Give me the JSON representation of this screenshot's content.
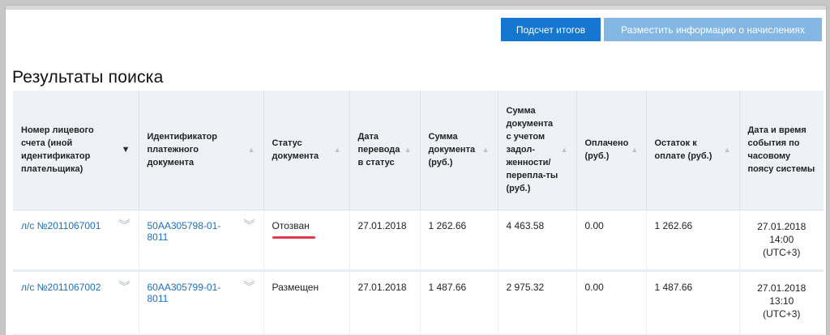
{
  "toolbar": {
    "totals_label": "Подсчет итогов",
    "publish_label": "Разместить информацию о начислениях"
  },
  "page": {
    "title": "Результаты поиска"
  },
  "table": {
    "columns": [
      {
        "label": "Номер лицевого счета (иной идентификатор плательщика)",
        "sort": "desc"
      },
      {
        "label": "Идентификатор платежного документа",
        "sort": "asc"
      },
      {
        "label": "Статус документа",
        "sort": "asc"
      },
      {
        "label": "Дата перевода в статус",
        "sort": "asc"
      },
      {
        "label": "Сумма документа (руб.)",
        "sort": "asc"
      },
      {
        "label": "Сумма документа с учетом задол-женности/ перепла-ты (руб.)",
        "sort": "asc"
      },
      {
        "label": "Оплачено (руб.)",
        "sort": "asc"
      },
      {
        "label": "Остаток к оплате (руб.)",
        "sort": "asc"
      },
      {
        "label": "Дата и время события по часовому поясу системы",
        "sort": "none"
      }
    ],
    "rows": [
      {
        "account": "л/с №2011067001",
        "doc_id": "50AA305798-01-8011",
        "status": "Отозван",
        "status_date": "27.01.2018",
        "amount": "1 262.66",
        "amount_with_debt": "4 463.58",
        "paid": "0.00",
        "remaining": "1 262.66",
        "event_date": "27.01.2018",
        "event_time": "14:00",
        "event_tz": "(UTC+3)"
      },
      {
        "account": "л/с №2011067002",
        "doc_id": "60AA305799-01-8011",
        "status": "Размещен",
        "status_date": "27.01.2018",
        "amount": "1 487.66",
        "amount_with_debt": "2 975.32",
        "paid": "0.00",
        "remaining": "1 487.66",
        "event_date": "27.01.2018",
        "event_time": "13:10",
        "event_tz": "(UTC+3)"
      }
    ]
  },
  "icons": {
    "sort_desc": "▼",
    "sort_asc": "▲",
    "expand": "︾"
  },
  "colors": {
    "primary_button": "#1577d0",
    "secondary_button": "#84b7e4",
    "link": "#1a6fc4",
    "highlight_underline": "#e23a4a"
  }
}
